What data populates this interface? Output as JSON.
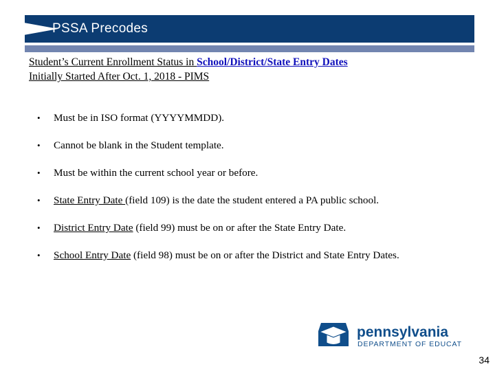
{
  "slide": {
    "title": "PSSA Precodes",
    "page_number": "34",
    "colors": {
      "banner": "#0c3c72",
      "underbar": "#7285b0",
      "link_blue": "#1111bb",
      "text": "#000000",
      "logo_blue": "#104e8b"
    }
  },
  "heading": {
    "line1_plain": "Student’s Current Enrollment Status in ",
    "line1_emphasis": "School/District/State Entry Dates",
    "line2_plain": "Initially Started After Oct. 1, 2018 - PIMS"
  },
  "bullets": [
    {
      "underlined": "",
      "text": "Must be in ISO format (YYYYMMDD)."
    },
    {
      "underlined": "",
      "text": "Cannot be blank in the Student template."
    },
    {
      "underlined": "",
      "text": "Must be within the current school year or before."
    },
    {
      "underlined": "State Entry Date ",
      "text": "(field 109) is the date the student entered a PA public school."
    },
    {
      "underlined": "District Entry Date",
      "text": " (field 99) must be on or after the State Entry Date."
    },
    {
      "underlined": "School Entry Date",
      "text": " (field 98) must be on or after the District and State Entry Dates."
    }
  ],
  "logo": {
    "wordmark": "pennsylvania",
    "subtitle": "DEPARTMENT OF EDUCATION",
    "icon": "keystone-graduation-cap-icon"
  }
}
